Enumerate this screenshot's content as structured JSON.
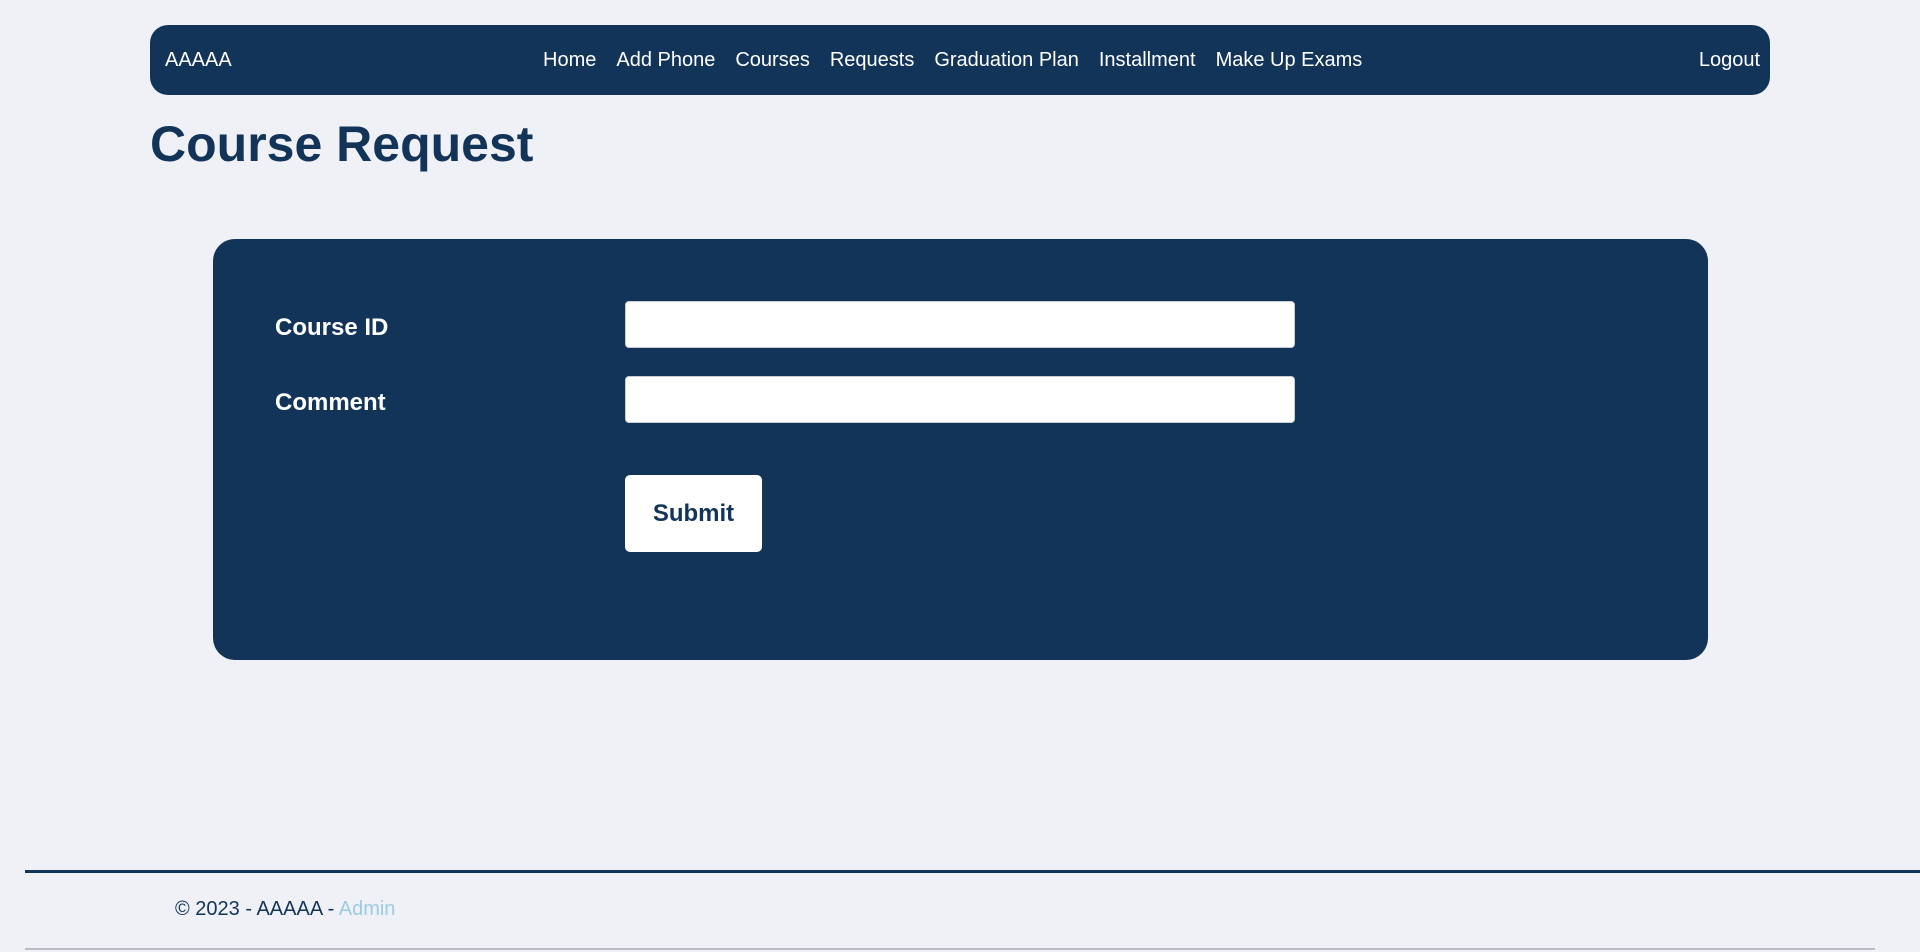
{
  "navbar": {
    "brand": "AAAAA",
    "links": [
      "Home",
      "Add Phone",
      "Courses",
      "Requests",
      "Graduation Plan",
      "Installment",
      "Make Up Exams"
    ],
    "logout": "Logout"
  },
  "page": {
    "title": "Course Request"
  },
  "form": {
    "course_id_label": "Course ID",
    "course_id_value": "",
    "comment_label": "Comment",
    "comment_value": "",
    "submit_label": "Submit"
  },
  "footer": {
    "text": "© 2023 - AAAAA - ",
    "link_label": "Admin"
  },
  "colors": {
    "primary": "#133459",
    "background": "#eff1f6",
    "link": "#9ccbe6"
  }
}
